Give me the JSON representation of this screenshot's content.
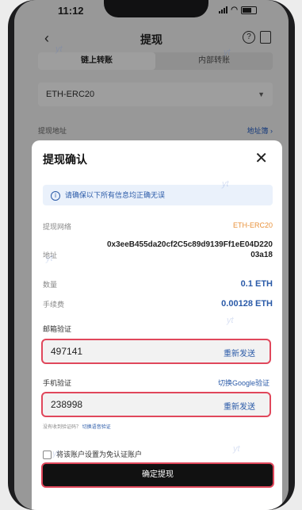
{
  "status": {
    "time": "11:12"
  },
  "header": {
    "title": "提现",
    "help_icon": "?"
  },
  "tabs": [
    {
      "label": "链上转账",
      "active": true
    },
    {
      "label": "内部转账",
      "active": false
    }
  ],
  "network_select": {
    "value": "ETH-ERC20"
  },
  "address_row": {
    "label": "提现地址",
    "link": "地址簿 ›"
  },
  "sheet": {
    "title": "提现确认",
    "close": "✕",
    "notice": "请确保以下所有信息均正确无误",
    "rows": {
      "network": {
        "label": "提现网络",
        "value": "ETH-ERC20"
      },
      "address": {
        "label": "地址",
        "value": "0x3eeB455da20cf2C5c89d9139Ff1eE04D22003a18"
      },
      "amount": {
        "label": "数量",
        "value": "0.1 ETH"
      },
      "fee": {
        "label": "手续费",
        "value": "0.00128 ETH"
      }
    },
    "email": {
      "label": "邮箱验证",
      "code": "497141",
      "resend": "重新发送"
    },
    "phone": {
      "label": "手机验证",
      "switch": "切换Google验证",
      "code": "238998",
      "resend": "重新发送"
    },
    "hint": {
      "text": "没有收到验证码？",
      "link": "切换语音验证"
    },
    "checkbox": {
      "label": "将该账户设置为免认证账户"
    },
    "confirm": "确定提现"
  },
  "watermark": "yt",
  "colors": {
    "accent": "#2a5aa8",
    "highlight": "#e0475b",
    "fee": "#e8913a"
  }
}
